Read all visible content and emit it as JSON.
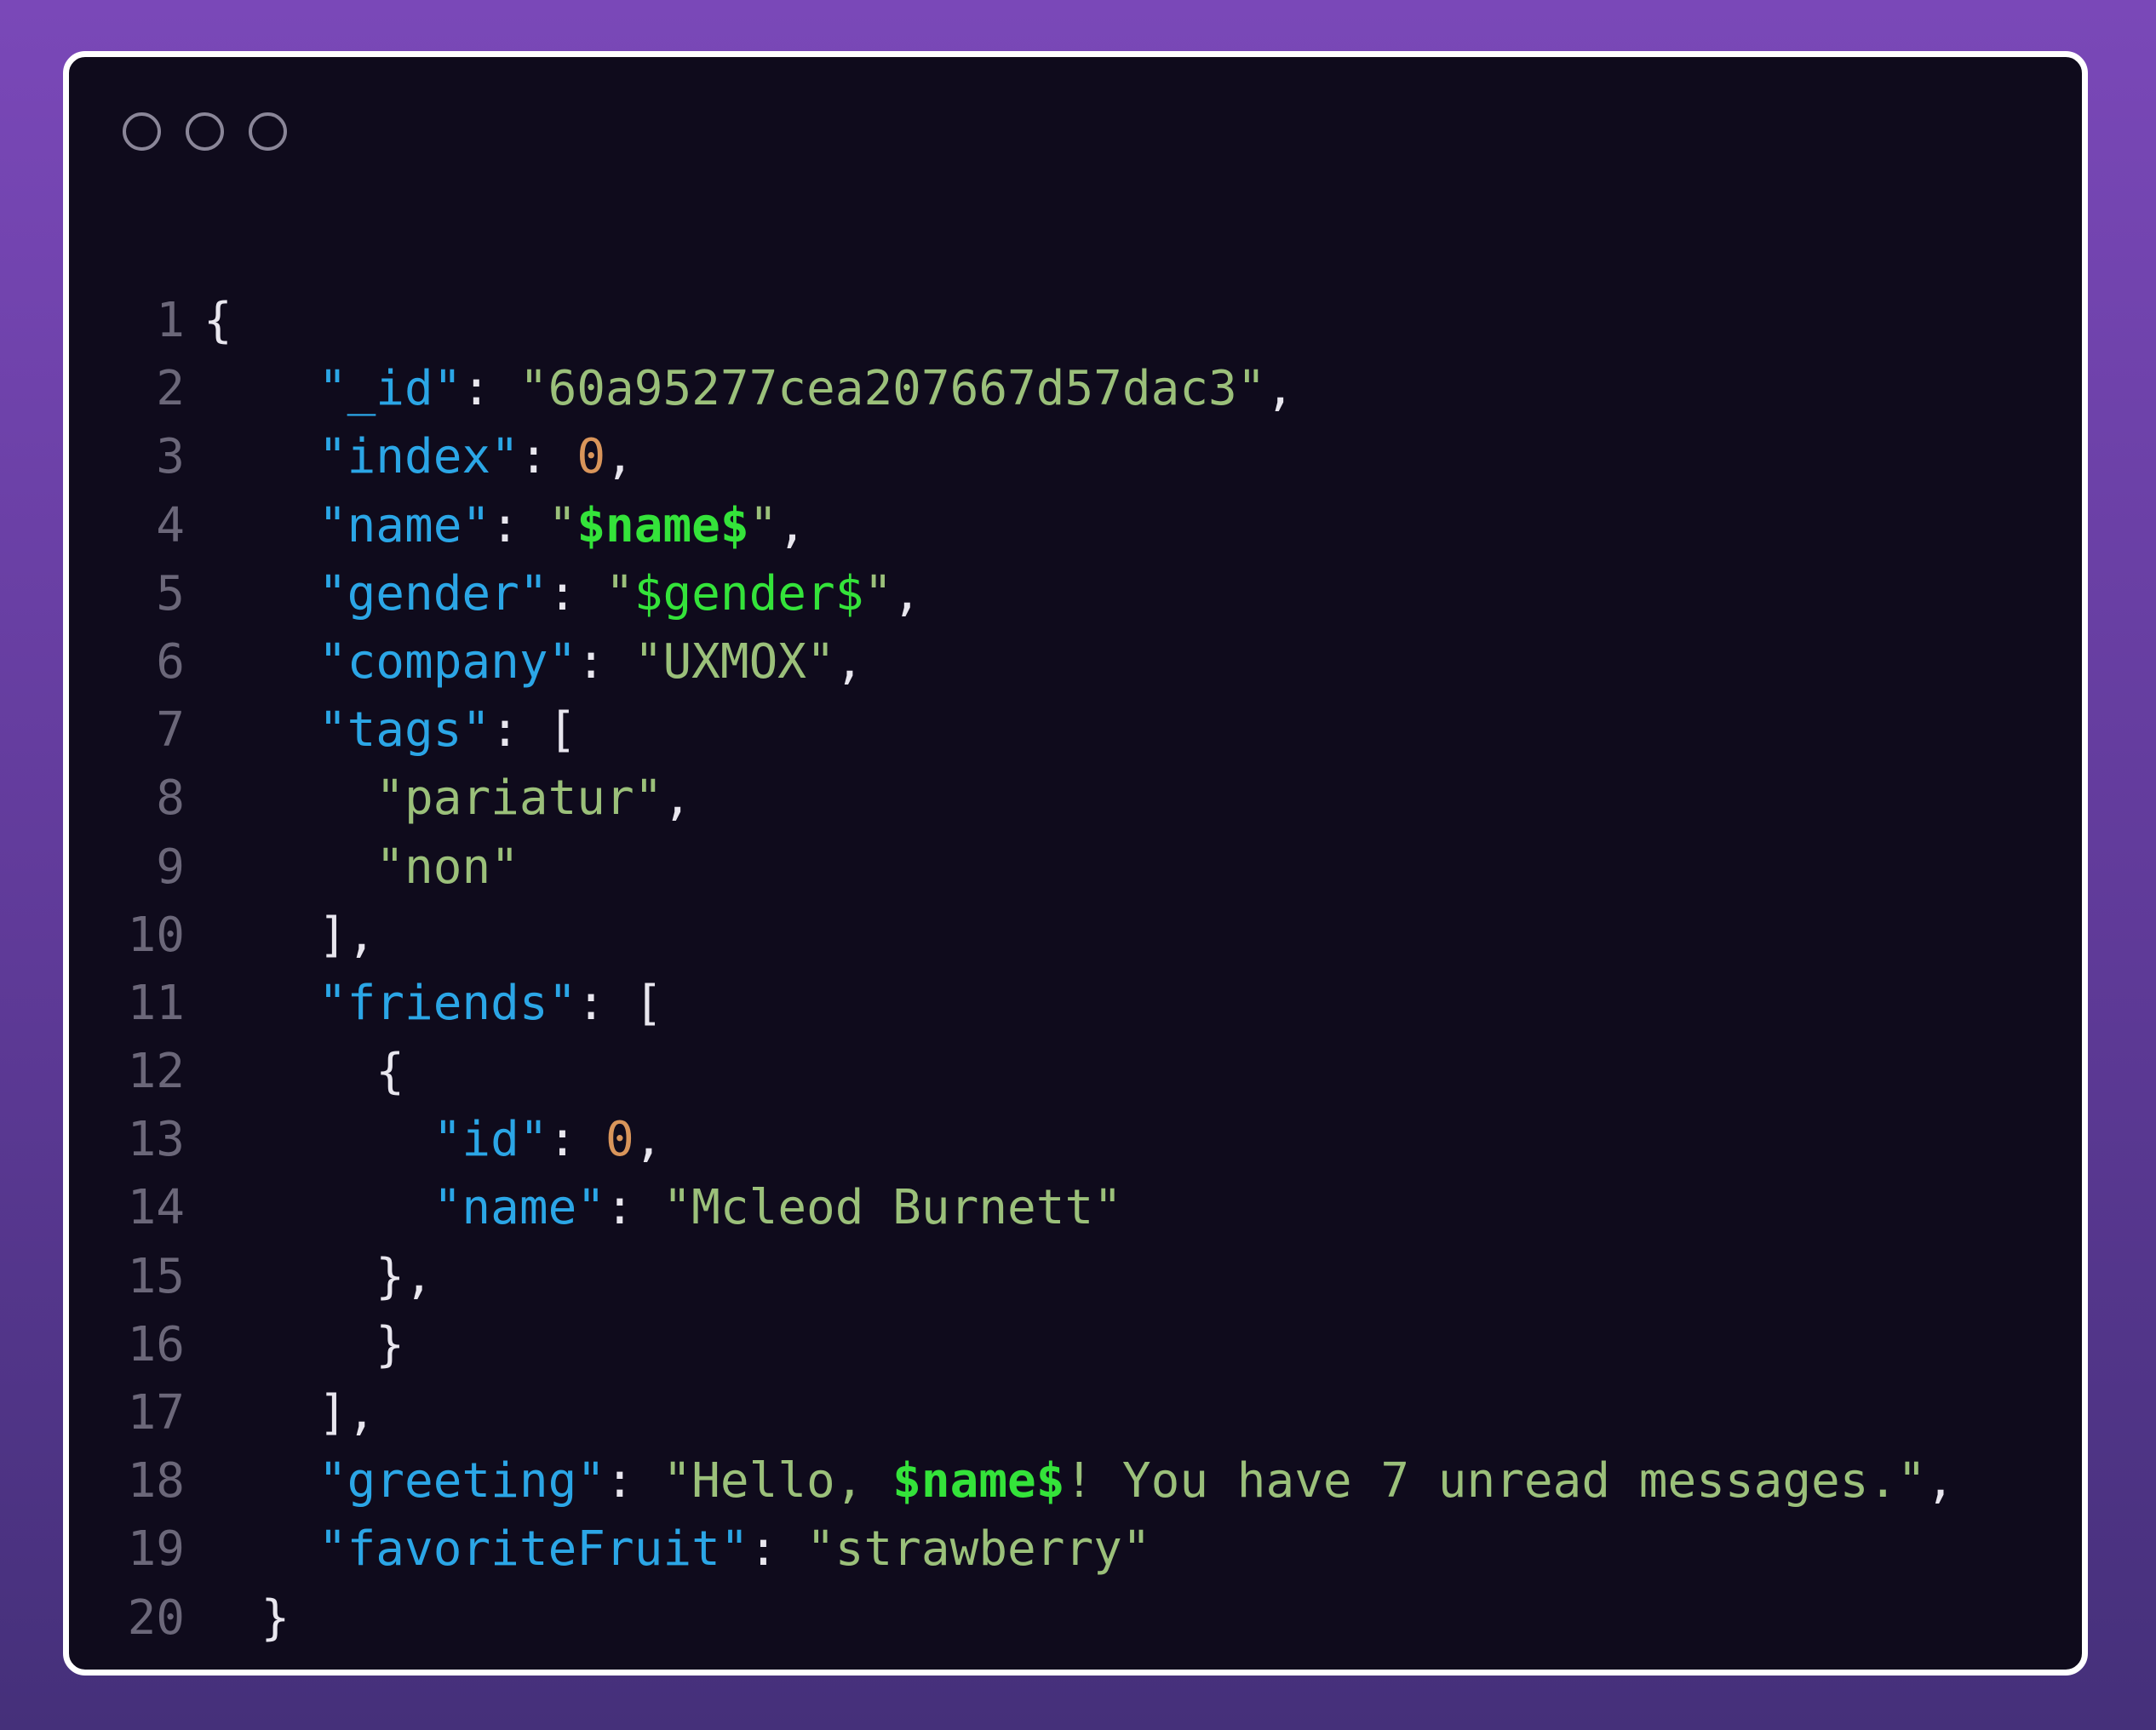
{
  "window": {
    "controls": [
      "window-dot-1",
      "window-dot-2",
      "window-dot-3"
    ]
  },
  "colors": {
    "background": "#0f0b1c",
    "key": "#2ba6e6",
    "string": "#9bc07a",
    "number": "#d9955a",
    "variable": "#34e33a",
    "line_number": "#6b6779"
  },
  "lines": [
    {
      "num": "1",
      "tokens": [
        {
          "t": "{",
          "c": "p"
        }
      ]
    },
    {
      "num": "2",
      "tokens": [
        {
          "t": "    ",
          "c": "p"
        },
        {
          "t": "\"_id\"",
          "c": "k"
        },
        {
          "t": ": ",
          "c": "p"
        },
        {
          "t": "\"60a95277cea207667d57dac3\"",
          "c": "s"
        },
        {
          "t": ",",
          "c": "p"
        }
      ]
    },
    {
      "num": "3",
      "tokens": [
        {
          "t": "    ",
          "c": "p"
        },
        {
          "t": "\"index\"",
          "c": "k"
        },
        {
          "t": ": ",
          "c": "p"
        },
        {
          "t": "0",
          "c": "n"
        },
        {
          "t": ",",
          "c": "p"
        }
      ]
    },
    {
      "num": "4",
      "tokens": [
        {
          "t": "    ",
          "c": "p"
        },
        {
          "t": "\"name\"",
          "c": "k"
        },
        {
          "t": ": ",
          "c": "p"
        },
        {
          "t": "\"",
          "c": "s"
        },
        {
          "t": "$name$",
          "c": "vb"
        },
        {
          "t": "\"",
          "c": "s"
        },
        {
          "t": ",",
          "c": "p"
        }
      ]
    },
    {
      "num": "5",
      "tokens": [
        {
          "t": "    ",
          "c": "p"
        },
        {
          "t": "\"gender\"",
          "c": "k"
        },
        {
          "t": ": ",
          "c": "p"
        },
        {
          "t": "\"",
          "c": "s"
        },
        {
          "t": "$gender$",
          "c": "v"
        },
        {
          "t": "\"",
          "c": "s"
        },
        {
          "t": ",",
          "c": "p"
        }
      ]
    },
    {
      "num": "6",
      "tokens": [
        {
          "t": "    ",
          "c": "p"
        },
        {
          "t": "\"company\"",
          "c": "k"
        },
        {
          "t": ": ",
          "c": "p"
        },
        {
          "t": "\"UXMOX\"",
          "c": "s"
        },
        {
          "t": ",",
          "c": "p"
        }
      ]
    },
    {
      "num": "7",
      "tokens": [
        {
          "t": "    ",
          "c": "p"
        },
        {
          "t": "\"tags\"",
          "c": "k"
        },
        {
          "t": ": [",
          "c": "p"
        }
      ]
    },
    {
      "num": "8",
      "tokens": [
        {
          "t": "      ",
          "c": "p"
        },
        {
          "t": "\"pariatur\"",
          "c": "s"
        },
        {
          "t": ",",
          "c": "p"
        }
      ]
    },
    {
      "num": "9",
      "tokens": [
        {
          "t": "      ",
          "c": "p"
        },
        {
          "t": "\"non\"",
          "c": "s"
        }
      ]
    },
    {
      "num": "10",
      "tokens": [
        {
          "t": "    ",
          "c": "p"
        },
        {
          "t": "],",
          "c": "p"
        }
      ]
    },
    {
      "num": "11",
      "tokens": [
        {
          "t": "    ",
          "c": "p"
        },
        {
          "t": "\"friends\"",
          "c": "k"
        },
        {
          "t": ": [",
          "c": "p"
        }
      ]
    },
    {
      "num": "12",
      "tokens": [
        {
          "t": "      ",
          "c": "p"
        },
        {
          "t": "{",
          "c": "p"
        }
      ]
    },
    {
      "num": "13",
      "tokens": [
        {
          "t": "        ",
          "c": "p"
        },
        {
          "t": "\"id\"",
          "c": "k"
        },
        {
          "t": ": ",
          "c": "p"
        },
        {
          "t": "0",
          "c": "n"
        },
        {
          "t": ",",
          "c": "p"
        }
      ]
    },
    {
      "num": "14",
      "tokens": [
        {
          "t": "        ",
          "c": "p"
        },
        {
          "t": "\"name\"",
          "c": "k"
        },
        {
          "t": ": ",
          "c": "p"
        },
        {
          "t": "\"Mcleod Burnett\"",
          "c": "s"
        }
      ]
    },
    {
      "num": "15",
      "tokens": [
        {
          "t": "      ",
          "c": "p"
        },
        {
          "t": "},",
          "c": "p"
        }
      ]
    },
    {
      "num": "16",
      "tokens": [
        {
          "t": "      ",
          "c": "p"
        },
        {
          "t": "}",
          "c": "p"
        }
      ]
    },
    {
      "num": "17",
      "tokens": [
        {
          "t": "    ",
          "c": "p"
        },
        {
          "t": "],",
          "c": "p"
        }
      ]
    },
    {
      "num": "18",
      "tokens": [
        {
          "t": "    ",
          "c": "p"
        },
        {
          "t": "\"greeting\"",
          "c": "k"
        },
        {
          "t": ": ",
          "c": "p"
        },
        {
          "t": "\"Hello, ",
          "c": "s"
        },
        {
          "t": "$name$",
          "c": "vb"
        },
        {
          "t": "! You have 7 unread messages.\"",
          "c": "s"
        },
        {
          "t": ",",
          "c": "p"
        }
      ]
    },
    {
      "num": "19",
      "tokens": [
        {
          "t": "    ",
          "c": "p"
        },
        {
          "t": "\"favoriteFruit\"",
          "c": "k"
        },
        {
          "t": ": ",
          "c": "p"
        },
        {
          "t": "\"strawberry\"",
          "c": "s"
        }
      ]
    },
    {
      "num": "20",
      "tokens": [
        {
          "t": "  ",
          "c": "p"
        },
        {
          "t": "}",
          "c": "p"
        }
      ]
    }
  ]
}
